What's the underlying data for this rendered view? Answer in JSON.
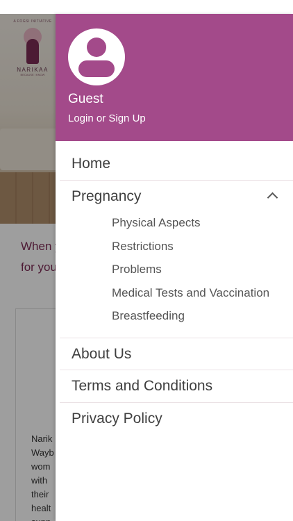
{
  "background": {
    "logo_tagline": "A FOGSI INITIATIVE",
    "logo_name": "NARIKAA",
    "logo_subtitle": "BECAUSE I KNOW",
    "intro_line_1": "When y",
    "intro_line_2": "for you",
    "para_lines": [
      "Narik",
      "Wayb",
      "wom",
      "with",
      "their",
      "healt",
      "supp"
    ]
  },
  "drawer": {
    "header_color": "#a34a8a",
    "user_name": "Guest",
    "login_label": "Login or Sign Up",
    "avatar_icon": "user-avatar-icon"
  },
  "menu": {
    "home": "Home",
    "pregnancy": {
      "label": "Pregnancy",
      "expanded": true,
      "sub_items": [
        "Physical Aspects",
        "Restrictions",
        "Problems",
        "Medical Tests and Vaccination",
        "Breastfeeding"
      ]
    },
    "about": "About Us",
    "terms": "Terms and Conditions",
    "privacy": "Privacy Policy"
  }
}
